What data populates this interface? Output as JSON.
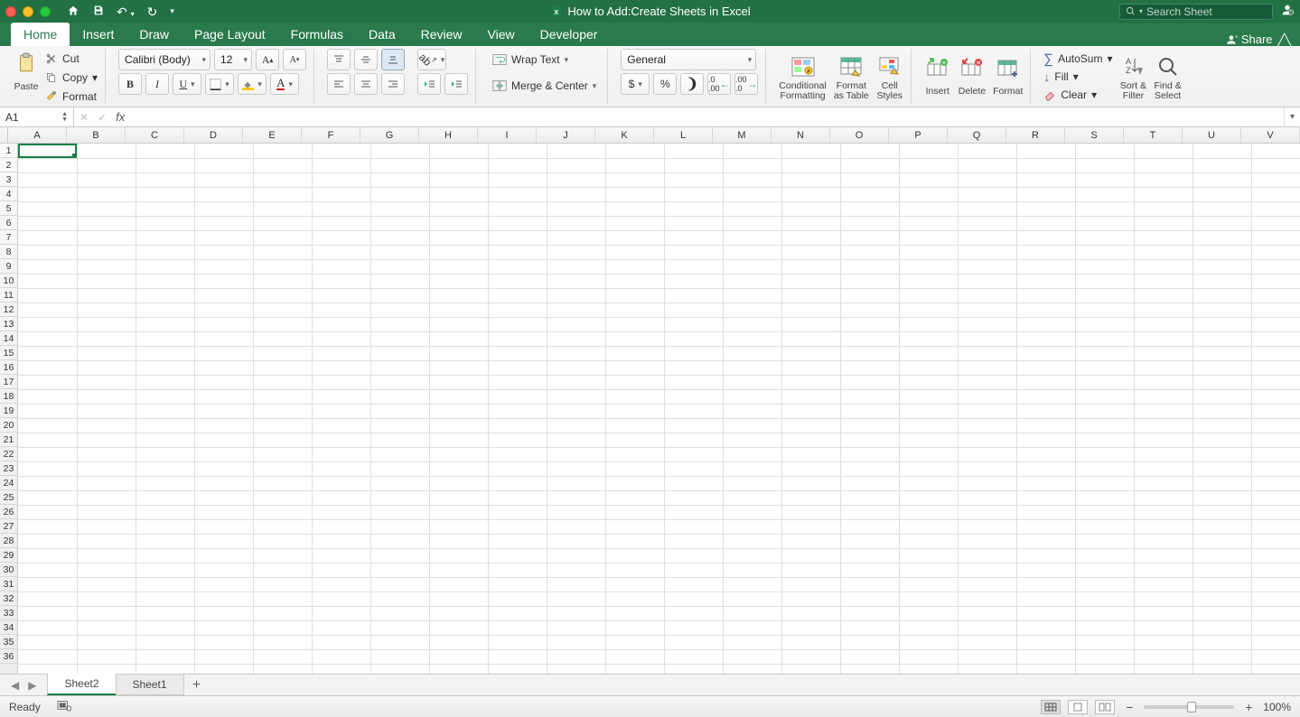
{
  "titlebar": {
    "doc_title": "How to Add:Create Sheets in Excel",
    "search_placeholder": "Search Sheet"
  },
  "tabs": {
    "items": [
      "Home",
      "Insert",
      "Draw",
      "Page Layout",
      "Formulas",
      "Data",
      "Review",
      "View",
      "Developer"
    ],
    "active": "Home",
    "share": "Share"
  },
  "ribbon": {
    "clipboard": {
      "paste": "Paste",
      "cut": "Cut",
      "copy": "Copy",
      "format": "Format"
    },
    "font": {
      "name": "Calibri (Body)",
      "size": "12"
    },
    "alignment": {
      "wrap": "Wrap Text",
      "merge": "Merge & Center"
    },
    "number": {
      "format": "General"
    },
    "tables": {
      "cond": "Conditional\nFormatting",
      "fat": "Format\nas Table",
      "styles": "Cell\nStyles"
    },
    "cells": {
      "insert": "Insert",
      "delete": "Delete",
      "format": "Format"
    },
    "editing": {
      "autosum": "AutoSum",
      "fill": "Fill",
      "clear": "Clear",
      "sort": "Sort &\nFilter",
      "find": "Find &\nSelect"
    }
  },
  "formula": {
    "cell_ref": "A1"
  },
  "grid": {
    "cols": [
      "A",
      "B",
      "C",
      "D",
      "E",
      "F",
      "G",
      "H",
      "I",
      "J",
      "K",
      "L",
      "M",
      "N",
      "O",
      "P",
      "Q",
      "R",
      "S",
      "T",
      "U",
      "V"
    ],
    "rows": 36
  },
  "sheets": {
    "tabs": [
      "Sheet2",
      "Sheet1"
    ],
    "active": "Sheet2"
  },
  "status": {
    "ready": "Ready",
    "zoom": "100%"
  }
}
